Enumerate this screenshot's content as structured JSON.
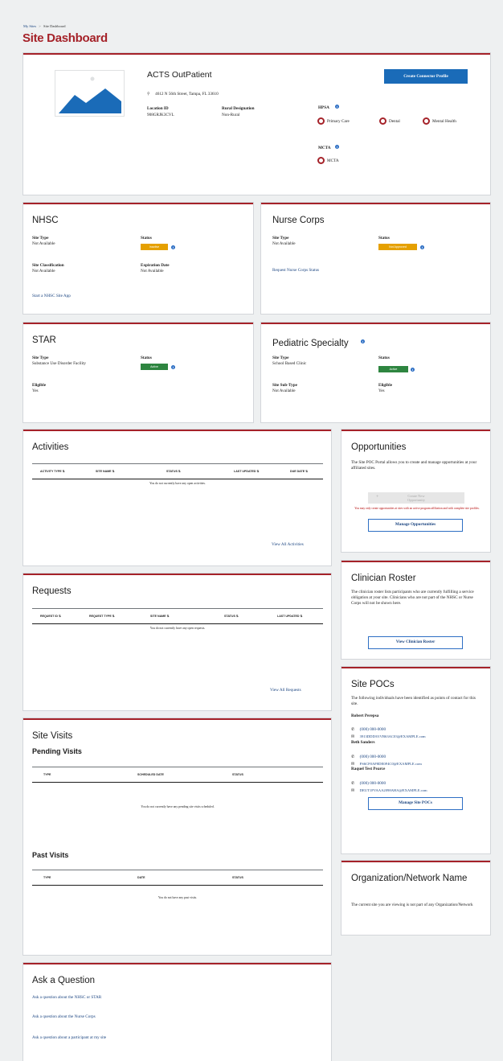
{
  "breadcrumb": {
    "link": "My Sites",
    "separator": ">",
    "current": "Site Dashboard"
  },
  "page_title": "Site Dashboard",
  "site": {
    "name": "ACTS OutPatient",
    "address": "4612 N 56th Street, Tampa, FL 33610",
    "location_id_label": "Location ID",
    "location_id_value": "908GRJK3CVL",
    "rural_label": "Rural Designation",
    "rural_value": "Non-Rural",
    "create_button": "Create Connector Profile",
    "hpsa_label": "HPSA",
    "hpsa_items": [
      "Primary Care",
      "Dental",
      "Mental Health"
    ],
    "mcta_label": "MCTA",
    "mcta_items": [
      "MCTA"
    ]
  },
  "nhsc": {
    "title": "NHSC",
    "site_type_label": "Site Type",
    "site_type_value": "Not Available",
    "status_label": "Status",
    "status_value": "Inactive",
    "classification_label": "Site Classification",
    "classification_value": "Not Available",
    "expiration_label": "Expiration Date",
    "expiration_value": "Not Available",
    "link": "Start a NHSC Site App"
  },
  "nurse": {
    "title": "Nurse Corps",
    "site_type_label": "Site Type",
    "site_type_value": "Not Available",
    "status_label": "Status",
    "status_value": "Not Approved",
    "link": "Request Nurse Corps Status"
  },
  "star": {
    "title": "STAR",
    "site_type_label": "Site Type",
    "site_type_value": "Substance Use Disorder Facility",
    "status_label": "Status",
    "status_value": "Active",
    "eligible_label": "Eligible",
    "eligible_value": "Yes"
  },
  "pediatric": {
    "title": "Pediatric Specialty",
    "site_type_label": "Site Type",
    "site_type_value": "School Based Clinic",
    "status_label": "Status",
    "status_value": "Active",
    "subtype_label": "Site Sub-Type",
    "subtype_value": "Not Available",
    "eligible_label": "Eligible",
    "eligible_value": "Yes"
  },
  "activities": {
    "title": "Activities",
    "columns": [
      "ACTIVITY TYPE",
      "SITE NAME",
      "STATUS",
      "LAST UPDATED",
      "DUE DATE"
    ],
    "empty": "You do not currently have any open activities.",
    "link": "View All Activities"
  },
  "requests": {
    "title": "Requests",
    "columns": [
      "REQUEST ID",
      "REQUEST TYPE",
      "SITE NAME",
      "STATUS",
      "LAST UPDATED"
    ],
    "empty": "You do not currently have any open requests.",
    "link": "View All Requests"
  },
  "visits": {
    "title": "Site Visits",
    "pending_title": "Pending Visits",
    "pending_columns": [
      "TYPE",
      "SCHEDULED DATE",
      "STATUS"
    ],
    "pending_empty": "You do not currently have any pending site visits scheduled.",
    "past_title": "Past Visits",
    "past_columns": [
      "TYPE",
      "DATE",
      "STATUS"
    ],
    "past_empty": "You do not have any past visits."
  },
  "ask": {
    "title": "Ask a Question",
    "links": [
      "Ask a question about the NHSC or STAR",
      "Ask a question about the Nurse Corps",
      "Ask a question about a participant at my site"
    ]
  },
  "opportunities": {
    "title": "Opportunities",
    "desc": "The Site POC Portal allows you to create and manage opportunities at your affiliated sites.",
    "create_button": "Create New Opportunity",
    "warning": "You may only create opportunities at sites with an active program affiliation and with complete site profiles.",
    "manage_button": "Manage Opportunities"
  },
  "roster": {
    "title": "Clinician Roster",
    "desc": "The clinician roster lists participants who are currently fulfilling a service obligation at your site. Clinicians who are not part of the NHSC or Nurse Corps will not be shown here.",
    "button": "View Clinician Roster"
  },
  "pocs": {
    "title": "Site POCs",
    "desc": "The following individuals have been identified as points of contact for this site.",
    "people": [
      {
        "name": "Robert Perepsa",
        "phone": "(000) 000-0000",
        "email": "3913DDD/01VB63AC03@EXAMPLE.com"
      },
      {
        "name": "Beth Sanders",
        "phone": "(000) 000-0000",
        "email": "FS6CF0AF8DE0F4C0@EXAMPLE.com"
      },
      {
        "name": "Raquel Test Pearce",
        "phone": "(000) 000-0000",
        "email": "DEUT1FVAAA2098AHA@EXAMPLE.com"
      }
    ],
    "button": "Manage Site POCs"
  },
  "org": {
    "title": "Organization/Network Name",
    "desc": "The current site you are viewing is not part of any Organization/Network"
  },
  "colors": {
    "accent": "#a52229",
    "link": "#1a4480",
    "primary": "#1a6bb8",
    "active": "#2e8540",
    "warning": "#e5a000"
  }
}
